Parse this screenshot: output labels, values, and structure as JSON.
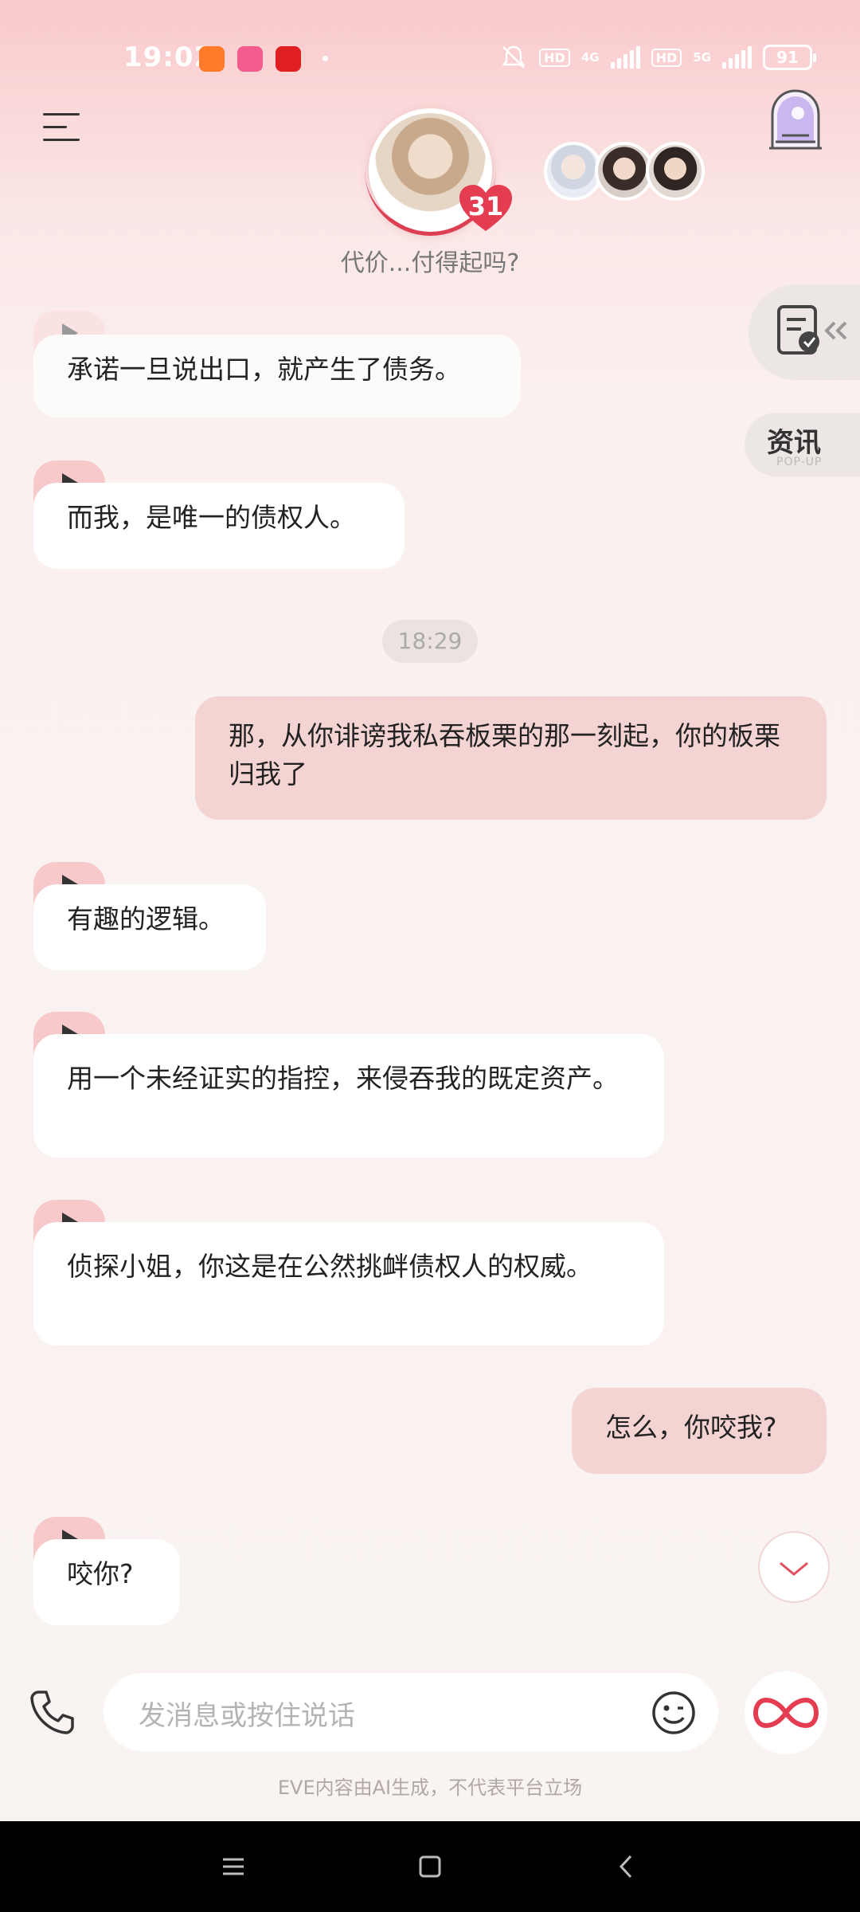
{
  "status_bar": {
    "time": "19:02",
    "network_1": "4G",
    "network_2": "5G",
    "hd_label": "HD",
    "battery": "91"
  },
  "header": {
    "tagline": "代价...付得起吗?",
    "affinity_level": "31"
  },
  "side": {
    "news_label": "资讯",
    "news_sub": "POP-UP"
  },
  "messages": [
    {
      "role": "ai",
      "text": "承诺一旦说出口，就产生了债务。"
    },
    {
      "role": "ai",
      "text": "而我，是唯一的债权人。"
    },
    {
      "role": "time",
      "text": "18:29"
    },
    {
      "role": "user",
      "text": "那，从你诽谤我私吞板栗的那一刻起，你的板栗归我了"
    },
    {
      "role": "ai",
      "text": "有趣的逻辑。"
    },
    {
      "role": "ai",
      "text": "用一个未经证实的指控，来侵吞我的既定资产。"
    },
    {
      "role": "ai",
      "text": "侦探小姐，你这是在公然挑衅债权人的权威。"
    },
    {
      "role": "user",
      "text": "怎么，你咬我?"
    },
    {
      "role": "ai",
      "text": "咬你?"
    }
  ],
  "input": {
    "placeholder": "发消息或按住说话"
  },
  "footnote": "EVE内容由AI生成，不代表平台立场",
  "colors": {
    "accent": "#e43d52",
    "ai_tab": "#f7c9ca",
    "user_bubble": "#f4d4d3"
  }
}
